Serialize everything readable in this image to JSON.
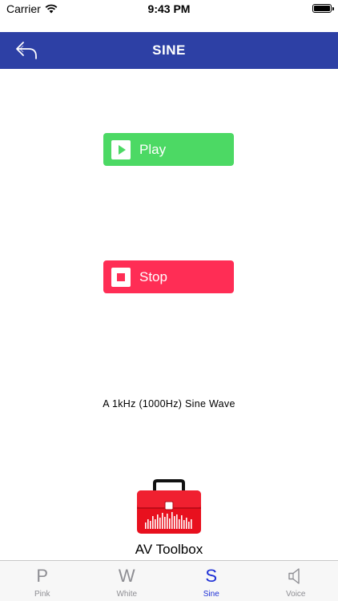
{
  "status_bar": {
    "carrier": "Carrier",
    "time": "9:43 PM"
  },
  "nav": {
    "title": "SINE",
    "back_icon": "back-arrow-icon"
  },
  "controls": {
    "play_label": "Play",
    "stop_label": "Stop"
  },
  "description": "A 1kHz (1000Hz) Sine Wave",
  "branding": {
    "label": "AV Toolbox",
    "icon": "toolbox-icon"
  },
  "tabs": [
    {
      "glyph": "P",
      "label": "Pink",
      "active": false
    },
    {
      "glyph": "W",
      "label": "White",
      "active": false
    },
    {
      "glyph": "S",
      "label": "Sine",
      "active": true
    },
    {
      "glyph": "",
      "label": "Voice",
      "active": false,
      "icon": "speaker-icon"
    }
  ],
  "colors": {
    "nav_bg": "#2d40a5",
    "play": "#4cd964",
    "stop": "#ff2d55",
    "toolbox_red": "#e8101e",
    "tab_active": "#1d2fd6",
    "tab_inactive": "#8e8e93"
  }
}
